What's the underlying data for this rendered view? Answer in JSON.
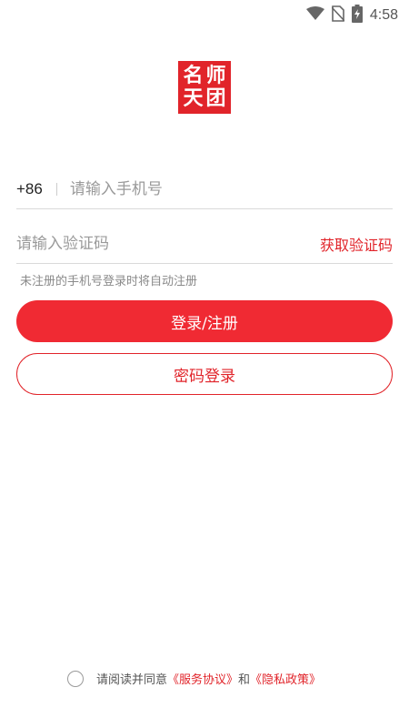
{
  "status_bar": {
    "time": "4:58",
    "icons": [
      "wifi-icon",
      "no-sim-icon",
      "battery-charging-icon"
    ]
  },
  "logo": {
    "chars": [
      "名",
      "师",
      "天",
      "团"
    ],
    "color": "#e1242a"
  },
  "phone": {
    "country_code": "+86",
    "placeholder": "请输入手机号"
  },
  "code": {
    "placeholder": "请输入验证码",
    "get_code_label": "获取验证码"
  },
  "hint": "未注册的手机号登录时将自动注册",
  "buttons": {
    "login_register": "登录/注册",
    "password_login": "密码登录"
  },
  "agreement": {
    "prefix": "请阅读并同意",
    "service_link": "《服务协议》",
    "conjunction": "和",
    "privacy_link": "《隐私政策》"
  },
  "colors": {
    "accent": "#e1242a",
    "button_fill": "#f02a33"
  }
}
